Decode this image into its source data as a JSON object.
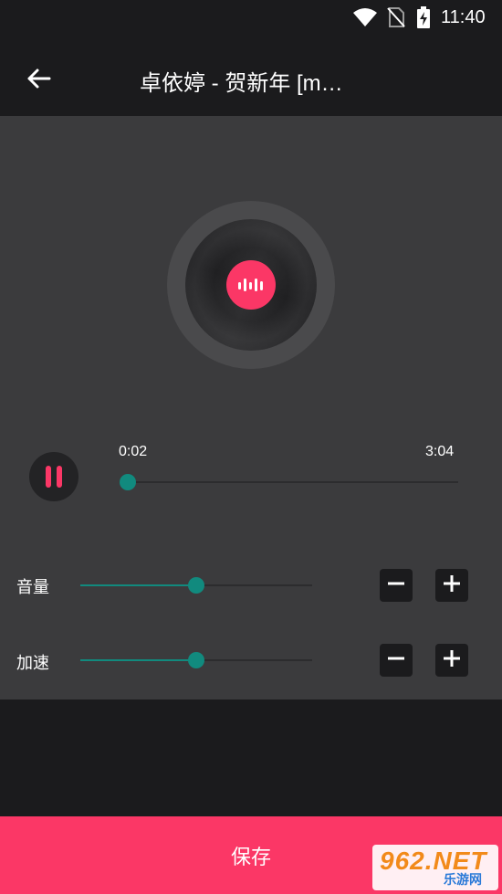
{
  "status_bar": {
    "time": "11:40",
    "icons": [
      "wifi-icon",
      "no-sim-icon",
      "battery-charging-icon"
    ]
  },
  "header": {
    "title": "卓依婷 - 贺新年 [m…",
    "back_icon": "arrow-left-icon"
  },
  "player": {
    "disc_icon": "sound-wave-icon",
    "state": "playing",
    "current_time": "0:02",
    "total_time": "3:04",
    "progress_fraction": 0.011
  },
  "controls": {
    "volume": {
      "label": "音量",
      "value_fraction": 0.5
    },
    "speed": {
      "label": "加速",
      "value_fraction": 0.5
    }
  },
  "save_button": {
    "label": "保存"
  },
  "watermark": {
    "text_big": "962.NET",
    "text_small": "乐游网"
  },
  "colors": {
    "accent": "#fb3766",
    "slider": "#118a7e",
    "panel": "#3b3b3d",
    "background": "#1b1b1d"
  }
}
